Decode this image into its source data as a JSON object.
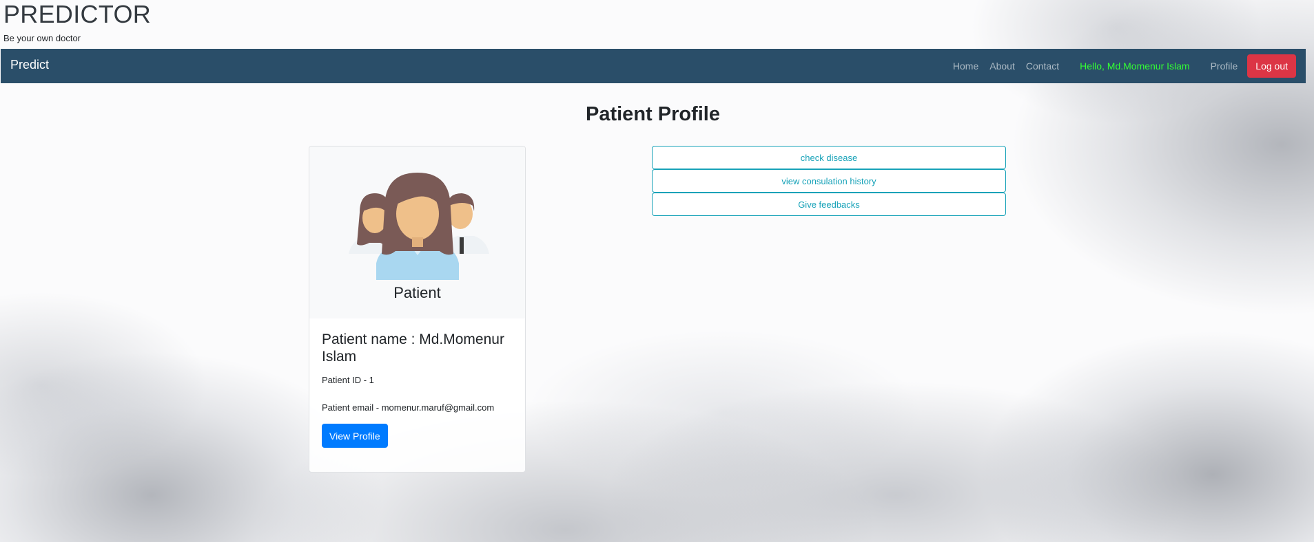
{
  "header": {
    "title": "PREDICTOR",
    "subtitle": "Be your own doctor"
  },
  "navbar": {
    "brand": "Predict",
    "links": [
      "Home",
      "About",
      "Contact"
    ],
    "greeting": "Hello, Md.Momenur Islam",
    "profile": "Profile",
    "logout": "Log out"
  },
  "main": {
    "title": "Patient Profile",
    "card": {
      "role": "Patient",
      "name": "Patient name : Md.Momenur Islam",
      "id_line": "Patient ID - 1",
      "email_line": "Patient email - momenur.maruf@gmail.com",
      "view_button": "View Profile"
    },
    "actions": [
      "check disease",
      "view consulation history",
      "Give feedbacks"
    ]
  },
  "colors": {
    "navbar": "#2a4e69",
    "greeting": "#33ff33",
    "logout": "#dc3545",
    "primary": "#007bff",
    "info": "#17a2b8"
  }
}
